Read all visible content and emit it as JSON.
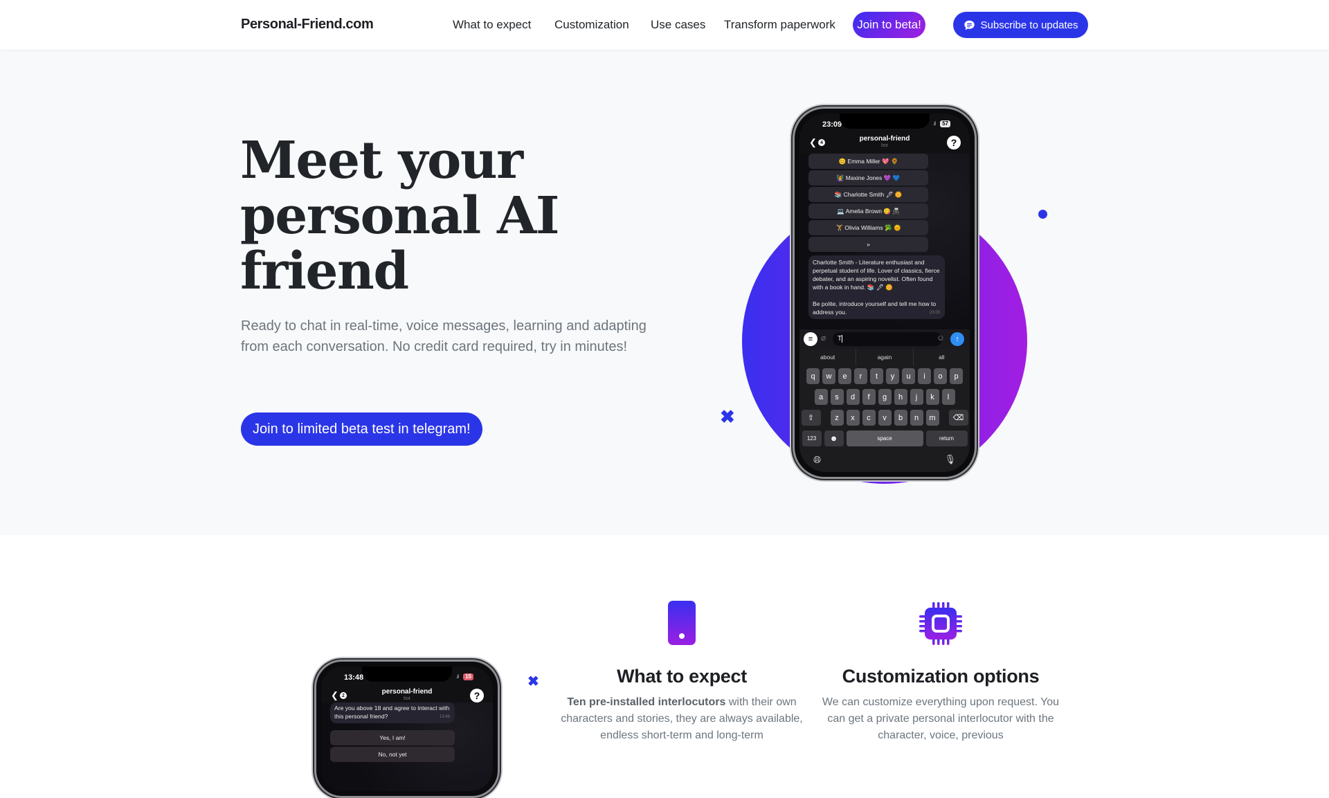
{
  "nav": {
    "brand": "Personal-Friend.com",
    "links": [
      "What to expect",
      "Customization",
      "Use cases",
      "Transform paperwork"
    ],
    "beta_button": "Join to beta!",
    "subscribe_button": "Subscribe to updates",
    "subscribe_icon": "chat-bubble-icon"
  },
  "hero": {
    "title_lines": [
      "Meet your",
      "personal AI",
      "friend"
    ],
    "subtitle": "Ready to chat in real-time, voice messages, learning and adapting from each conversation. No credit card required, try in minutes!",
    "cta": "Join to limited beta test in telegram!"
  },
  "colors": {
    "accent": "#2b35e8",
    "gradient_start": "#3a2ff0",
    "gradient_end": "#a21ee2",
    "hero_bg": "#f8f9fa",
    "text_dark": "#212529",
    "text_muted": "#6c757d"
  },
  "phone_main": {
    "time": "23:09",
    "battery": "57",
    "back_badge": "4",
    "chat_title": "personal-friend",
    "chat_subtitle": "bot",
    "help_icon": "?",
    "buttons": [
      "😊 Emma Miller 💖 🌻",
      "👩‍🏫 Maxine Jones 💜 💙",
      "📚 Charlotte Smith 🖋 🌼",
      "💻 Amelia Brown 😋 📠",
      "🏋 Olivia Williams 🥦 🌞",
      "»"
    ],
    "message_paragraphs": [
      "Charlotte Smith - Literature enthusiast and perpetual student of life. Lover of classics, fierce debater, and an aspiring novelist. Often found with a book in hand. 📚 🖋 🌼",
      "Be polite, introduce yourself and tell me how to address you."
    ],
    "message_time": "23:05",
    "input_value": "T",
    "suggestions": [
      "about",
      "again",
      "all"
    ],
    "keyboard_rows": [
      [
        "q",
        "w",
        "e",
        "r",
        "t",
        "y",
        "u",
        "i",
        "o",
        "p"
      ],
      [
        "a",
        "s",
        "d",
        "f",
        "g",
        "h",
        "j",
        "k",
        "l"
      ],
      [
        "z",
        "x",
        "c",
        "v",
        "b",
        "n",
        "m"
      ]
    ],
    "key_numbers": "123",
    "key_space": "space",
    "key_return": "return"
  },
  "phone_secondary": {
    "time": "13:48",
    "battery": "15",
    "back_badge": "2",
    "chat_title": "personal-friend",
    "chat_subtitle": "bot",
    "message": "Are you above 18 and agree to interact with this personal friend?",
    "message_time": "13:48",
    "buttons": [
      "Yes, I am!",
      "No, not yet"
    ]
  },
  "features": [
    {
      "icon": "smartphone-icon",
      "title": "What to expect",
      "text_bold": "Ten pre-installed interlocutors",
      "text": " with their own characters and stories, they are always available, endless short-term and long-term"
    },
    {
      "icon": "chip-icon",
      "title": "Customization options",
      "text": "We can customize everything upon request. You can get a private personal interlocutor with the character, voice, previous"
    }
  ]
}
